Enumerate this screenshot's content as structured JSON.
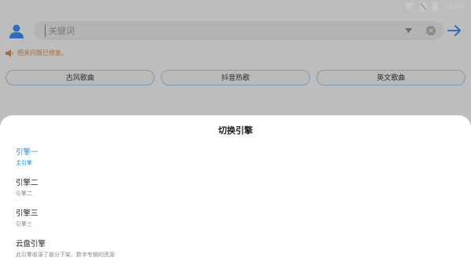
{
  "status_bar": {
    "time": "11:44"
  },
  "search": {
    "placeholder": "关键词"
  },
  "notice": {
    "text": "相关问题已修复。"
  },
  "categories": [
    "古风歌曲",
    "抖音热歌",
    "英文歌曲"
  ],
  "sheet": {
    "title": "切换引擎",
    "options": [
      {
        "label": "引擎一",
        "sub": "主引擎",
        "selected": true
      },
      {
        "label": "引擎二",
        "sub": "引擎二",
        "selected": false
      },
      {
        "label": "引擎三",
        "sub": "引擎三",
        "selected": false
      },
      {
        "label": "云盘引擎",
        "sub": "此引擎收录了部分下架、数字专辑的资源",
        "selected": false
      }
    ]
  },
  "colors": {
    "accent": "#2a8de0",
    "notice": "#d98a4a",
    "chip_border": "#9ec7ef"
  }
}
